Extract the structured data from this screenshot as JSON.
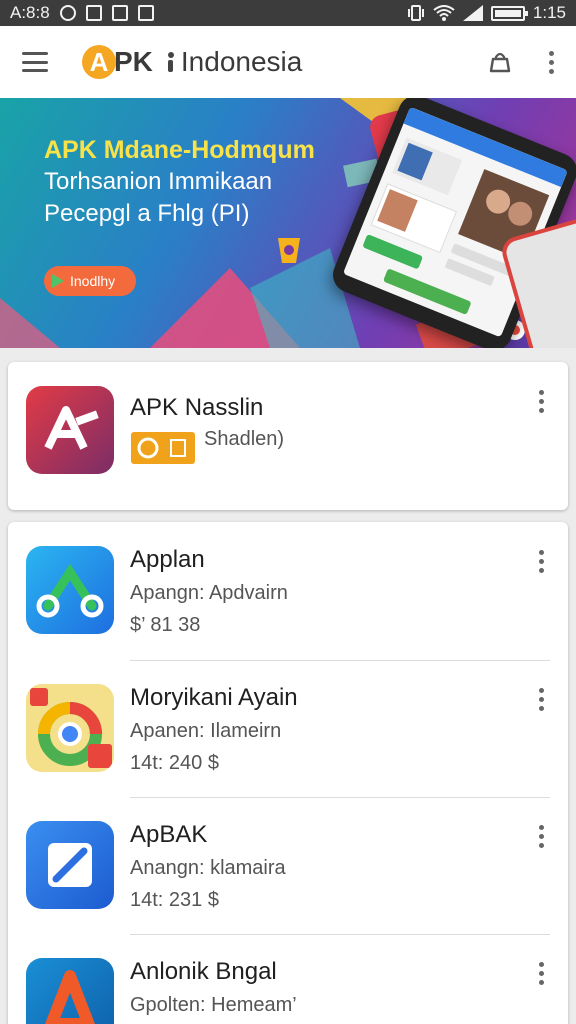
{
  "status_bar": {
    "carrier": "A:8:8",
    "time": "1:15"
  },
  "app_bar": {
    "logo_letter": "A",
    "logo_rest": "PK",
    "title": "Indonesia"
  },
  "banner": {
    "line1": "APK Mdane-Hodmqum",
    "line2": "Torhsanion Immikaan",
    "line3": "Pecepgl a Fhlg (PI)",
    "button_label": "Inodlhy"
  },
  "featured": {
    "name": "APK Nasslin",
    "subtitle": "Shadlen)"
  },
  "apps": [
    {
      "name": "Applan",
      "subtitle": "Apangn: Apdvairn",
      "price": "$’ 81 38"
    },
    {
      "name": "Moryikani Ayain",
      "subtitle": "Apanen: Ilameirn",
      "price": "14t: 240 $"
    },
    {
      "name": "ApBAK",
      "subtitle": "Anangn: klamaira",
      "price": "14t: 231 $"
    },
    {
      "name": "Anlonik Bngal",
      "subtitle": "Gpolten: Hemeam’",
      "price": ""
    }
  ],
  "colors": {
    "accent": "#f5a623",
    "banner_yellow": "#f7e24a",
    "badge": "#f0a21a"
  }
}
